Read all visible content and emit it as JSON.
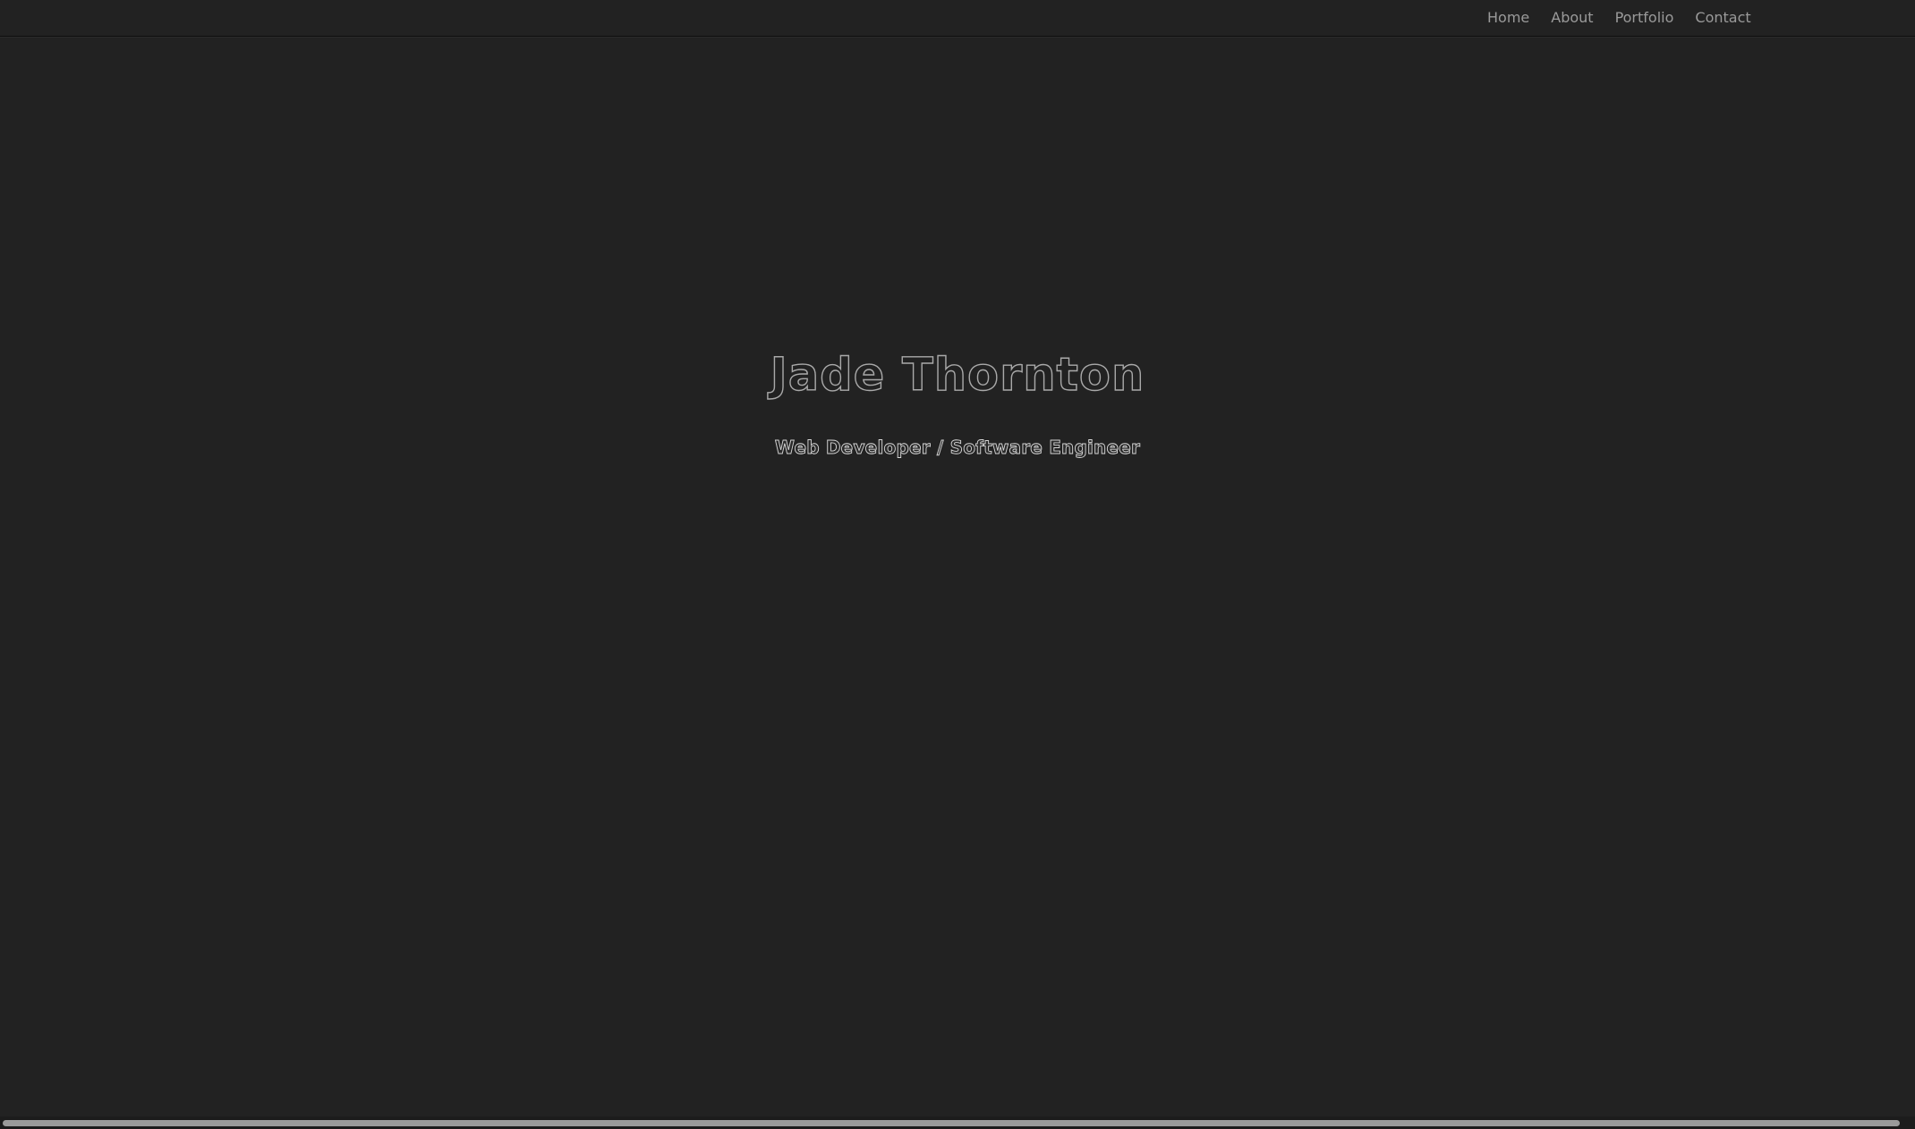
{
  "nav": {
    "items": [
      {
        "label": "Home"
      },
      {
        "label": "About"
      },
      {
        "label": "Portfolio"
      },
      {
        "label": "Contact"
      }
    ]
  },
  "hero": {
    "name": "Jade Thornton",
    "tagline": "Web Developer / Software Engineer"
  },
  "colors": {
    "background": "#222222",
    "nav_text": "#9a9a9a",
    "title_outline": "#a9a9a9",
    "tagline_outline": "#d6d6d6"
  }
}
